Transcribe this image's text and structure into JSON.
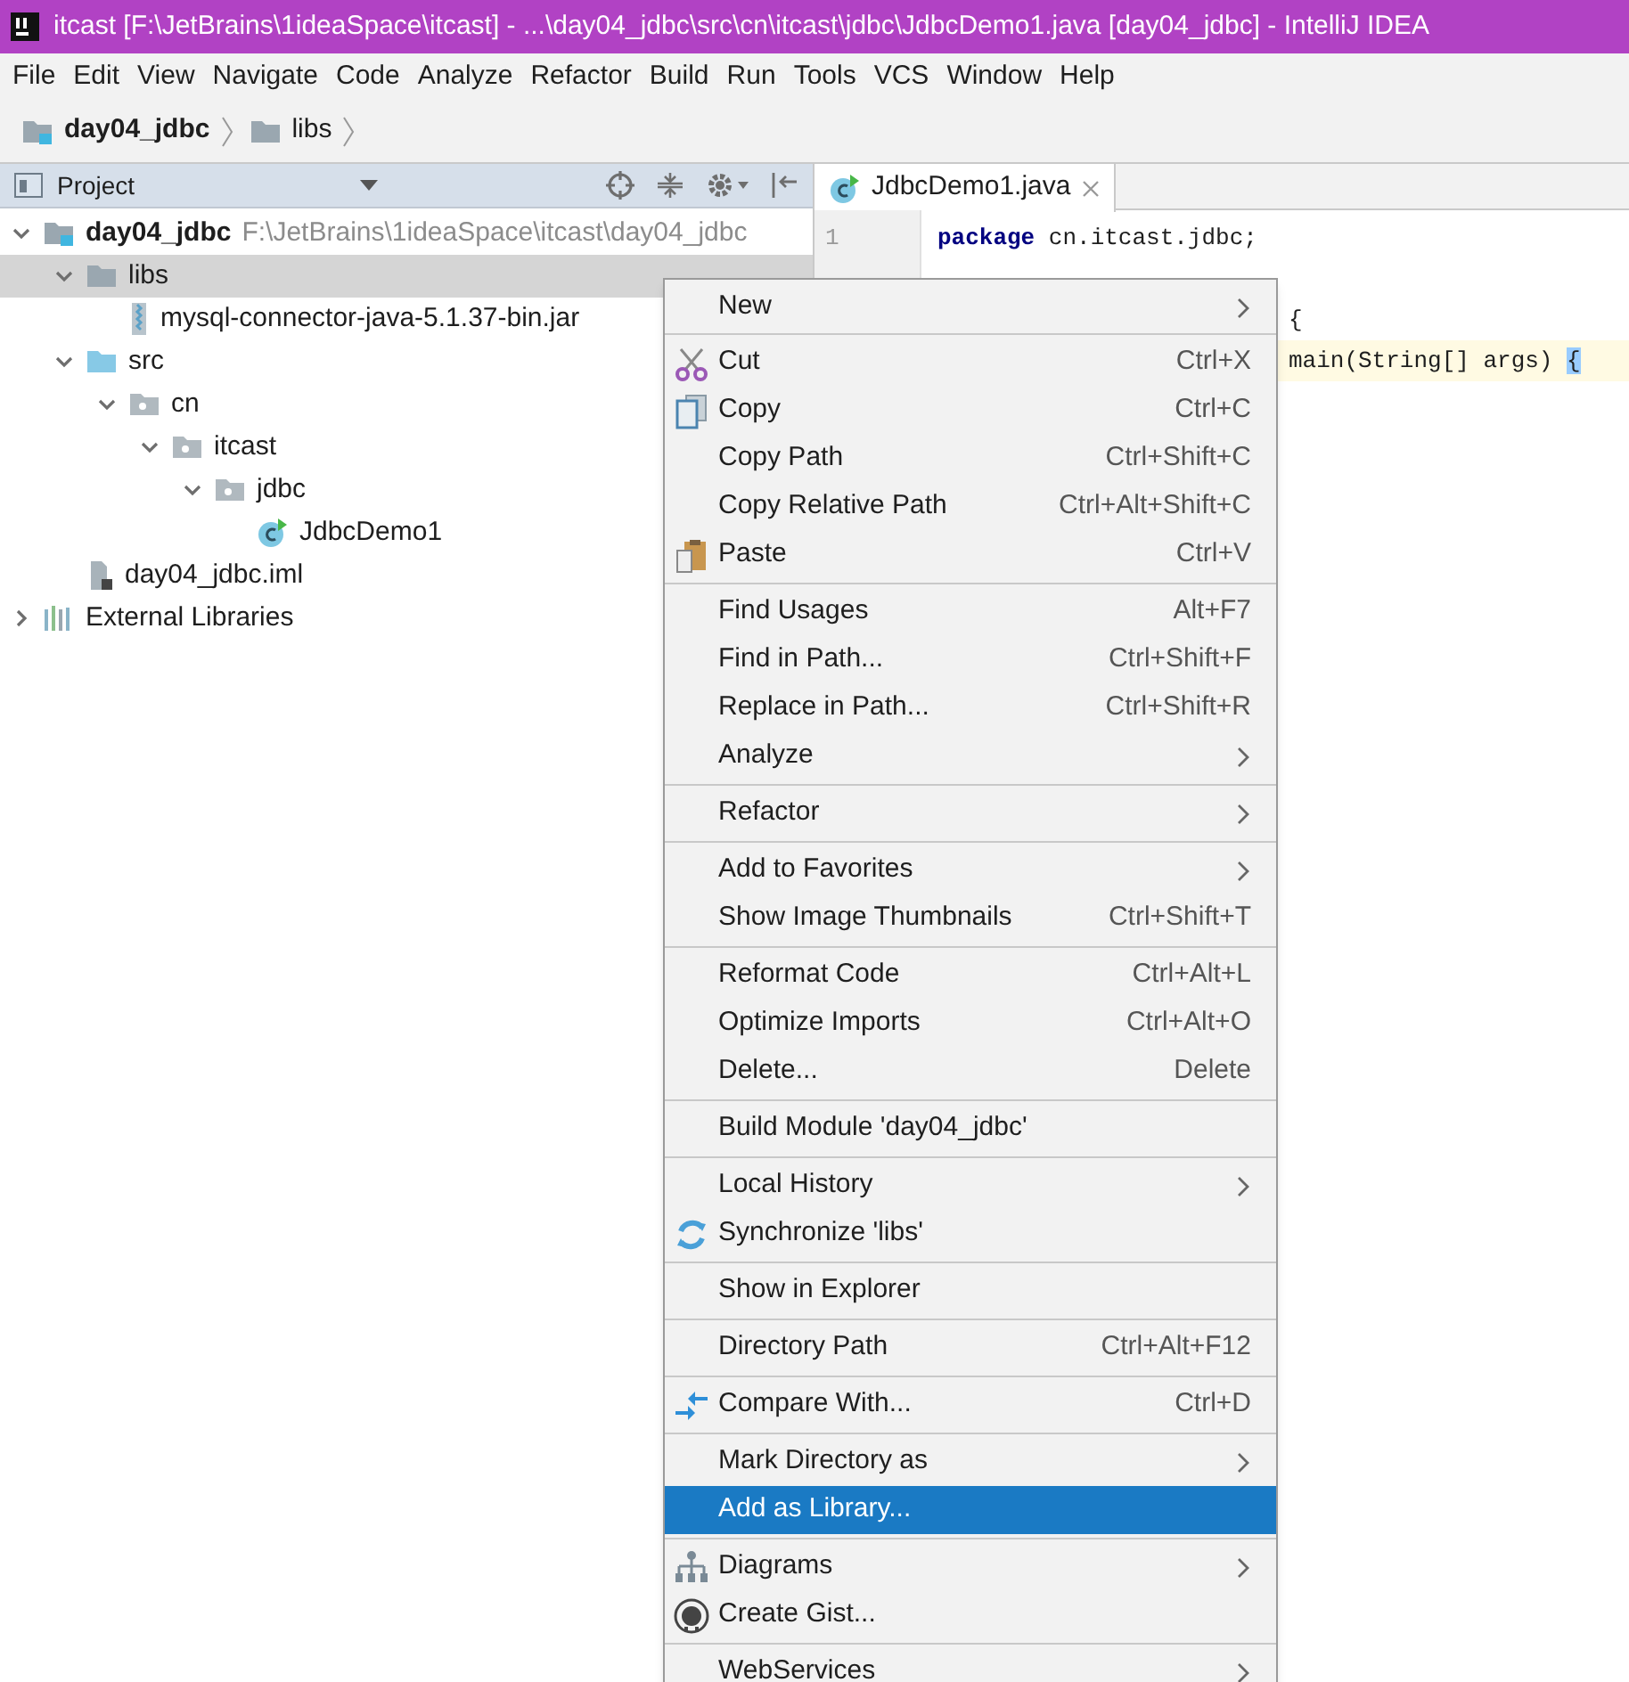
{
  "window": {
    "title": "itcast [F:\\JetBrains\\1ideaSpace\\itcast] - ...\\day04_jdbc\\src\\cn\\itcast\\jdbc\\JdbcDemo1.java [day04_jdbc] - IntelliJ IDEA"
  },
  "menu_bar": [
    "File",
    "Edit",
    "View",
    "Navigate",
    "Code",
    "Analyze",
    "Refactor",
    "Build",
    "Run",
    "Tools",
    "VCS",
    "Window",
    "Help"
  ],
  "breadcrumbs": [
    {
      "label": "day04_jdbc",
      "kind": "module"
    },
    {
      "label": "libs",
      "kind": "folder"
    }
  ],
  "project_panel": {
    "title": "Project",
    "tree": [
      {
        "label": "day04_jdbc",
        "path": "F:\\JetBrains\\1ideaSpace\\itcast\\day04_jdbc",
        "kind": "module",
        "expanded": true,
        "selected": false,
        "children": [
          {
            "label": "libs",
            "kind": "folder",
            "expanded": true,
            "selected": true,
            "children": [
              {
                "label": "mysql-connector-java-5.1.37-bin.jar",
                "kind": "jar",
                "selected": false
              }
            ]
          },
          {
            "label": "src",
            "kind": "source",
            "expanded": true,
            "selected": false,
            "children": [
              {
                "label": "cn",
                "kind": "package",
                "expanded": true,
                "selected": false,
                "children": [
                  {
                    "label": "itcast",
                    "kind": "package",
                    "expanded": true,
                    "selected": false,
                    "children": [
                      {
                        "label": "jdbc",
                        "kind": "package",
                        "expanded": true,
                        "selected": false,
                        "children": [
                          {
                            "label": "JdbcDemo1",
                            "kind": "class",
                            "selected": false
                          }
                        ]
                      }
                    ]
                  }
                ]
              }
            ]
          },
          {
            "label": "day04_jdbc.iml",
            "kind": "iml",
            "selected": false
          }
        ]
      },
      {
        "label": "External Libraries",
        "kind": "libraries",
        "expanded": false,
        "selected": false
      }
    ]
  },
  "editor": {
    "tab": "JdbcDemo1.java",
    "line_numbers": [
      "1"
    ],
    "lines": [
      {
        "keyword": "package",
        "text": " cn.itcast.jdbc;",
        "current": false
      },
      {
        "text": "{",
        "current": false
      },
      {
        "text": "main(String[] args) ",
        "brace": "{",
        "current": true
      }
    ]
  },
  "context_menu": {
    "groups": [
      [
        {
          "label": "New",
          "submenu": true,
          "selected": false
        }
      ],
      [
        {
          "label": "Cut",
          "shortcut": "Ctrl+X",
          "kind": "cut",
          "selected": false
        },
        {
          "label": "Copy",
          "shortcut": "Ctrl+C",
          "kind": "copy",
          "selected": false
        },
        {
          "label": "Copy Path",
          "shortcut": "Ctrl+Shift+C",
          "selected": false
        },
        {
          "label": "Copy Relative Path",
          "shortcut": "Ctrl+Alt+Shift+C",
          "selected": false
        },
        {
          "label": "Paste",
          "shortcut": "Ctrl+V",
          "kind": "paste",
          "selected": false
        }
      ],
      [
        {
          "label": "Find Usages",
          "shortcut": "Alt+F7",
          "selected": false
        },
        {
          "label": "Find in Path...",
          "shortcut": "Ctrl+Shift+F",
          "selected": false
        },
        {
          "label": "Replace in Path...",
          "shortcut": "Ctrl+Shift+R",
          "selected": false
        },
        {
          "label": "Analyze",
          "submenu": true,
          "selected": false
        }
      ],
      [
        {
          "label": "Refactor",
          "submenu": true,
          "selected": false
        }
      ],
      [
        {
          "label": "Add to Favorites",
          "submenu": true,
          "selected": false
        },
        {
          "label": "Show Image Thumbnails",
          "shortcut": "Ctrl+Shift+T",
          "selected": false
        }
      ],
      [
        {
          "label": "Reformat Code",
          "shortcut": "Ctrl+Alt+L",
          "selected": false
        },
        {
          "label": "Optimize Imports",
          "shortcut": "Ctrl+Alt+O",
          "selected": false
        },
        {
          "label": "Delete...",
          "shortcut": "Delete",
          "selected": false
        }
      ],
      [
        {
          "label": "Build Module 'day04_jdbc'",
          "selected": false
        }
      ],
      [
        {
          "label": "Local History",
          "submenu": true,
          "selected": false
        },
        {
          "label": "Synchronize 'libs'",
          "kind": "sync",
          "selected": false
        }
      ],
      [
        {
          "label": "Show in Explorer",
          "selected": false
        }
      ],
      [
        {
          "label": "Directory Path",
          "shortcut": "Ctrl+Alt+F12",
          "selected": false
        }
      ],
      [
        {
          "label": "Compare With...",
          "shortcut": "Ctrl+D",
          "kind": "compare",
          "selected": false
        }
      ],
      [
        {
          "label": "Mark Directory as",
          "submenu": true,
          "selected": false
        },
        {
          "label": "Add as Library...",
          "selected": true
        }
      ],
      [
        {
          "label": "Diagrams",
          "submenu": true,
          "kind": "diagram",
          "selected": false
        },
        {
          "label": "Create Gist...",
          "kind": "gist",
          "selected": false
        }
      ],
      [
        {
          "label": "WebServices",
          "submenu": true,
          "selected": false
        }
      ]
    ]
  }
}
